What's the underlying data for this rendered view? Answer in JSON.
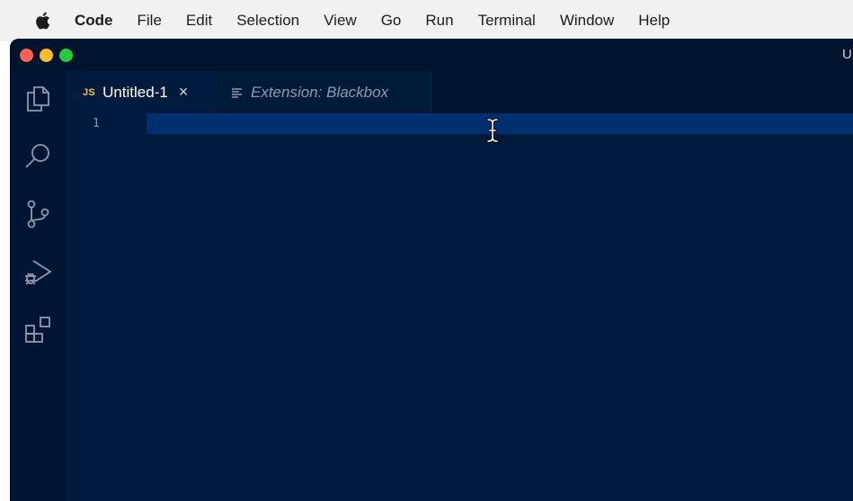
{
  "menubar": {
    "apple_icon": "apple-logo-icon",
    "items": [
      "Code",
      "File",
      "Edit",
      "Selection",
      "View",
      "Go",
      "Run",
      "Terminal",
      "Window",
      "Help"
    ]
  },
  "window": {
    "title": "U",
    "traffic_lights": {
      "close": "#fe5f57",
      "minimize": "#febc2e",
      "zoom": "#28c840"
    }
  },
  "activity_bar": {
    "icons": [
      "explorer-icon",
      "search-icon",
      "source-control-icon",
      "run-debug-icon",
      "extensions-icon"
    ]
  },
  "tabs": [
    {
      "badge": "JS",
      "label": "Untitled-1",
      "close": "×",
      "active": true
    },
    {
      "icon": "preview-lines-icon",
      "label": "Extension: Blackbox",
      "active": false
    }
  ],
  "editor": {
    "line_numbers": [
      "1"
    ],
    "background": "#001b3d",
    "current_line_color": "#003070"
  }
}
